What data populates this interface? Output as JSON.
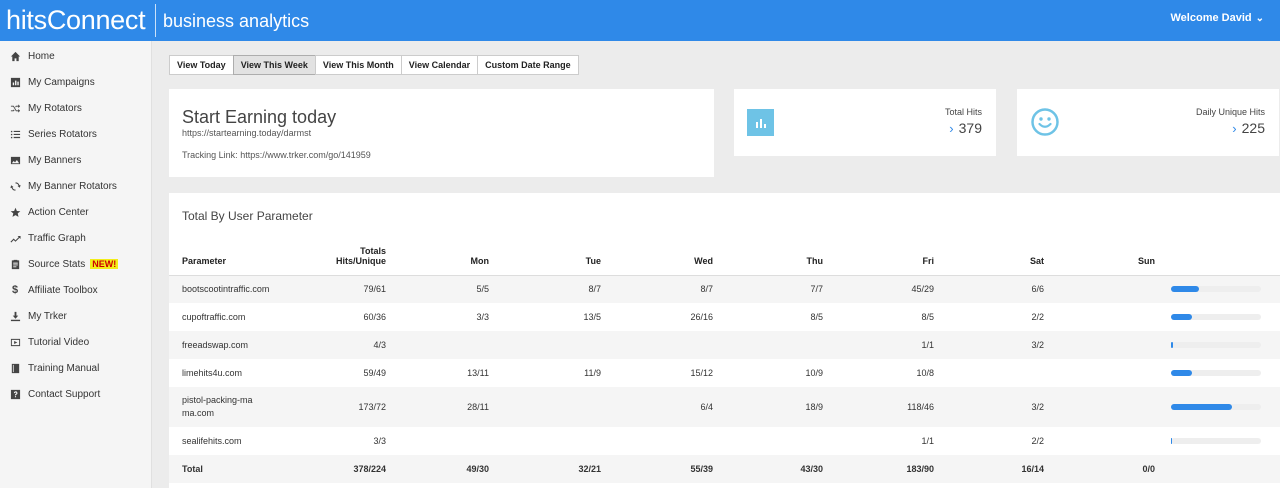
{
  "header": {
    "brand": "hitsConnect",
    "subtitle": "business analytics",
    "welcome": "Welcome David",
    "caret": "⌄"
  },
  "sidebar": {
    "items": [
      {
        "label": "Home",
        "icon": "home-icon"
      },
      {
        "label": "My Campaigns",
        "icon": "bar-chart-icon"
      },
      {
        "label": "My Rotators",
        "icon": "shuffle-icon"
      },
      {
        "label": "Series Rotators",
        "icon": "list-icon"
      },
      {
        "label": "My Banners",
        "icon": "image-icon"
      },
      {
        "label": "My Banner Rotators",
        "icon": "refresh-icon"
      },
      {
        "label": "Action Center",
        "icon": "star-icon"
      },
      {
        "label": "Traffic Graph",
        "icon": "trend-icon"
      },
      {
        "label": "Source Stats",
        "icon": "clipboard-icon",
        "badge": "NEW!"
      },
      {
        "label": "Affiliate Toolbox",
        "icon": "dollar-icon"
      },
      {
        "label": "My Trker",
        "icon": "download-icon"
      },
      {
        "label": "Tutorial Video",
        "icon": "video-icon"
      },
      {
        "label": "Training Manual",
        "icon": "book-icon"
      },
      {
        "label": "Contact Support",
        "icon": "help-icon"
      }
    ]
  },
  "toolbar": {
    "buttons": [
      {
        "label": "View Today",
        "active": false
      },
      {
        "label": "View This Week",
        "active": true
      },
      {
        "label": "View This Month",
        "active": false
      },
      {
        "label": "View Calendar",
        "active": false
      },
      {
        "label": "Custom Date Range",
        "active": false
      }
    ]
  },
  "campaign": {
    "title": "Start Earning today",
    "url": "https://startearning.today/darmst",
    "tracking": "Tracking Link: https://www.trker.com/go/141959"
  },
  "stats": {
    "total_hits_label": "Total Hits",
    "total_hits_value": "379",
    "daily_unique_label": "Daily Unique Hits",
    "daily_unique_value": "225",
    "chevron": "›"
  },
  "table": {
    "title": "Total By User Parameter",
    "headers": {
      "param": "Parameter",
      "totals_line1": "Totals",
      "totals_line2": "Hits/Unique",
      "mon": "Mon",
      "tue": "Tue",
      "wed": "Wed",
      "thu": "Thu",
      "fri": "Fri",
      "sat": "Sat",
      "sun": "Sun"
    },
    "rows": [
      {
        "param": "bootscootintraffic.com",
        "totals": "79/61",
        "mon": "5/5",
        "tue": "8/7",
        "wed": "8/7",
        "thu": "7/7",
        "fri": "45/29",
        "sat": "6/6",
        "sun": "",
        "bar": 0.31
      },
      {
        "param": "cupoftraffic.com",
        "totals": "60/36",
        "mon": "3/3",
        "tue": "13/5",
        "wed": "26/16",
        "thu": "8/5",
        "fri": "8/5",
        "sat": "2/2",
        "sun": "",
        "bar": 0.23
      },
      {
        "param": "freeadswap.com",
        "totals": "4/3",
        "mon": "",
        "tue": "",
        "wed": "",
        "thu": "",
        "fri": "1/1",
        "sat": "3/2",
        "sun": "",
        "bar": 0.02
      },
      {
        "param": "limehits4u.com",
        "totals": "59/49",
        "mon": "13/11",
        "tue": "11/9",
        "wed": "15/12",
        "thu": "10/9",
        "fri": "10/8",
        "sat": "",
        "sun": "",
        "bar": 0.23
      },
      {
        "param": "pistol-packing-mama.com",
        "totals": "173/72",
        "mon": "28/11",
        "tue": "",
        "wed": "6/4",
        "thu": "18/9",
        "fri": "118/46",
        "sat": "3/2",
        "sun": "",
        "bar": 0.68
      },
      {
        "param": "sealifehits.com",
        "totals": "3/3",
        "mon": "",
        "tue": "",
        "wed": "",
        "thu": "",
        "fri": "1/1",
        "sat": "2/2",
        "sun": "",
        "bar": 0.01
      }
    ],
    "total": {
      "param": "Total",
      "totals": "378/224",
      "mon": "49/30",
      "tue": "32/21",
      "wed": "55/39",
      "thu": "43/30",
      "fri": "183/90",
      "sat": "16/14",
      "sun": "0/0"
    }
  },
  "colors": {
    "brand": "#2f89e8",
    "stat_icon": "#6ec3e6",
    "badge_bg": "#f3ee18",
    "badge_text": "#cc0000"
  }
}
